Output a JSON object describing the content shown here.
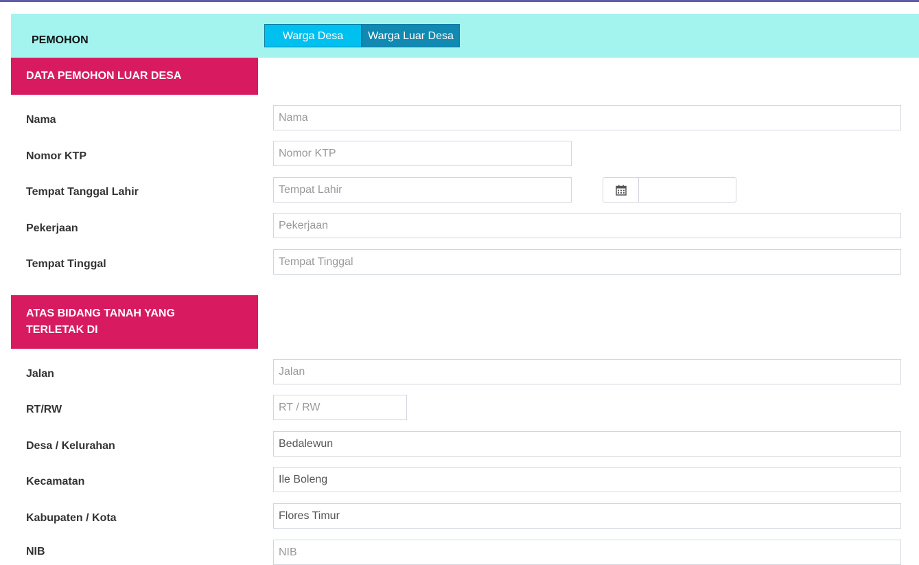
{
  "header": {
    "title": "PEMOHON",
    "tabs": [
      {
        "label": "Warga Desa",
        "active": false
      },
      {
        "label": "Warga Luar Desa",
        "active": true
      }
    ]
  },
  "colors": {
    "header_bg": "#a3f3ee",
    "section_bg": "#d81b60",
    "tab_primary": "#00c0ef",
    "tab_active": "#1189b1",
    "top_rule": "#605ca8"
  },
  "section_1": {
    "title": "DATA PEMOHON LUAR DESA",
    "fields": {
      "nama": {
        "label": "Nama",
        "placeholder": "Nama",
        "value": ""
      },
      "ktp": {
        "label": "Nomor KTP",
        "placeholder": "Nomor KTP",
        "value": ""
      },
      "ttl": {
        "label": "Tempat Tanggal Lahir",
        "placeholder": "Tempat Lahir",
        "value": "",
        "date_icon": "calendar-icon",
        "date_value": ""
      },
      "pekerjaan": {
        "label": "Pekerjaan",
        "placeholder": "Pekerjaan",
        "value": ""
      },
      "tinggal": {
        "label": "Tempat Tinggal",
        "placeholder": "Tempat Tinggal",
        "value": ""
      }
    }
  },
  "section_2": {
    "title_line1": "ATAS BIDANG TANAH YANG",
    "title_line2": "TERLETAK DI",
    "fields": {
      "jalan": {
        "label": "Jalan",
        "placeholder": "Jalan",
        "value": ""
      },
      "rtrw": {
        "label": "RT/RW",
        "placeholder": "RT / RW",
        "value": ""
      },
      "desa": {
        "label": "Desa / Kelurahan",
        "placeholder": "",
        "value": "Bedalewun"
      },
      "kecamatan": {
        "label": "Kecamatan",
        "placeholder": "",
        "value": "Ile Boleng"
      },
      "kabupaten": {
        "label": "Kabupaten / Kota",
        "placeholder": "",
        "value": "Flores Timur"
      },
      "nib": {
        "label": "NIB",
        "placeholder": "NIB",
        "value": ""
      }
    }
  }
}
